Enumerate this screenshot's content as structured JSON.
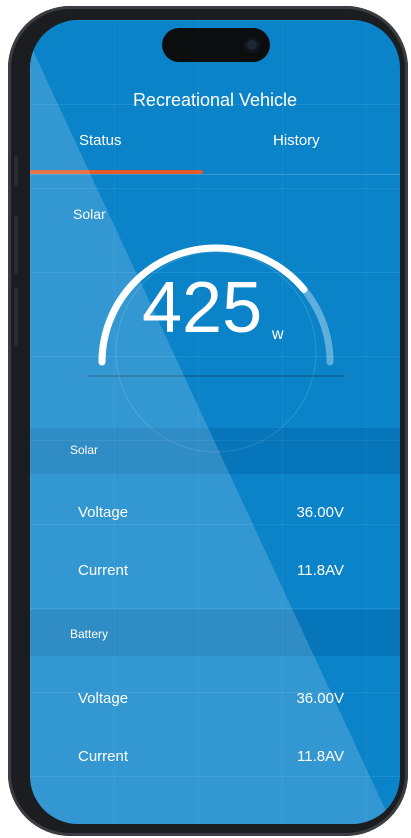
{
  "app": {
    "title": "Recreational Vehicle"
  },
  "tabs": [
    {
      "label": "Status",
      "active": true
    },
    {
      "label": "History",
      "active": false
    }
  ],
  "gauge": {
    "label": "Solar",
    "value": "425",
    "unit": "w",
    "fill_fraction": 0.78
  },
  "solar": {
    "header": "Solar",
    "rows": [
      {
        "label": "Voltage",
        "value": "36.00V"
      },
      {
        "label": "Current",
        "value": "11.8AV"
      }
    ]
  },
  "battery": {
    "header": "Battery",
    "rows": [
      {
        "label": "Voltage",
        "value": "36.00V"
      },
      {
        "label": "Current",
        "value": "11.8AV"
      }
    ]
  },
  "colors": {
    "background": "#0a83c8",
    "tab_indicator": "#e35a26",
    "text": "#ffffff"
  }
}
